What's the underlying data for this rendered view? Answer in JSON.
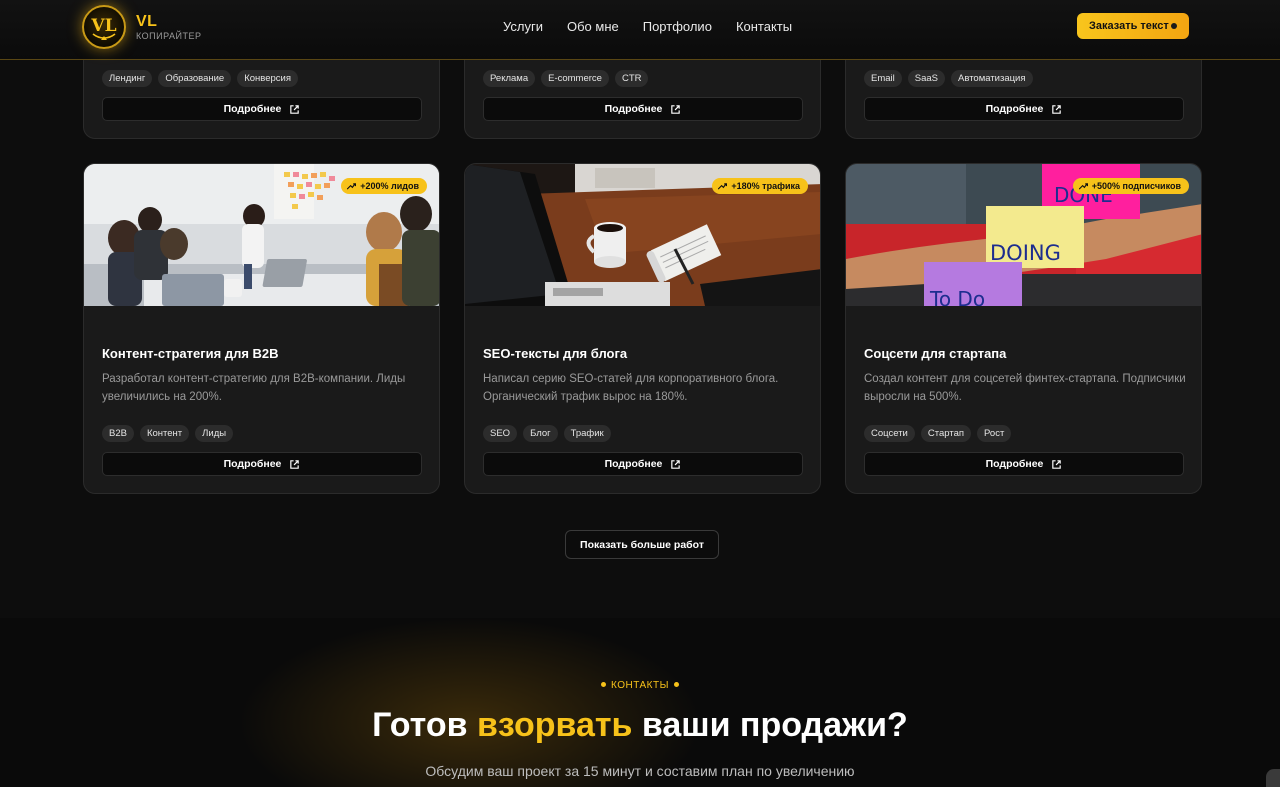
{
  "header": {
    "brand_name": "VL",
    "brand_subtitle": "КОПИРАЙТЕР",
    "logo_letters": "VL",
    "nav": [
      "Услуги",
      "Обо мне",
      "Портфолио",
      "Контакты"
    ],
    "cta": "Заказать текст"
  },
  "top_cards": [
    {
      "tags": [
        "Лендинг",
        "Образование",
        "Конверсия"
      ],
      "button": "Подробнее"
    },
    {
      "tags": [
        "Реклама",
        "E-commerce",
        "CTR"
      ],
      "button": "Подробнее"
    },
    {
      "tags": [
        "Email",
        "SaaS",
        "Автоматизация"
      ],
      "button": "Подробнее"
    }
  ],
  "cards": [
    {
      "badge": "+200% лидов",
      "title": "Контент-стратегия для B2B",
      "description": "Разработал контент-стратегию для B2B-компании. Лиды увеличились на 200%.",
      "tags": [
        "B2B",
        "Контент",
        "Лиды"
      ],
      "button": "Подробнее"
    },
    {
      "badge": "+180% трафика",
      "title": "SEO-тексты для блога",
      "description": "Написал серию SEO-статей для корпоративного блога. Органический трафик вырос на 180%.",
      "tags": [
        "SEO",
        "Блог",
        "Трафик"
      ],
      "button": "Подробнее"
    },
    {
      "badge": "+500% подписчиков",
      "title": "Соцсети для стартапа",
      "description": "Создал контент для соцсетей финтех-стартапа. Подписчики выросли на 500%.",
      "tags": [
        "Соцсети",
        "Стартап",
        "Рост"
      ],
      "button": "Подробнее",
      "sticky_notes": [
        "DONE",
        "DOING",
        "To Do"
      ]
    }
  ],
  "show_more": "Показать больше работ",
  "contacts": {
    "label": "КОНТАКТЫ",
    "title_before": "Готов ",
    "title_highlight": "взорвать",
    "title_after": " ваши продажи?",
    "text": "Обсудим ваш проект за 15 минут и составим план по увеличению"
  },
  "colors": {
    "accent": "#f7c21a",
    "background": "#0d0d0d",
    "card": "#1a1a1a"
  }
}
